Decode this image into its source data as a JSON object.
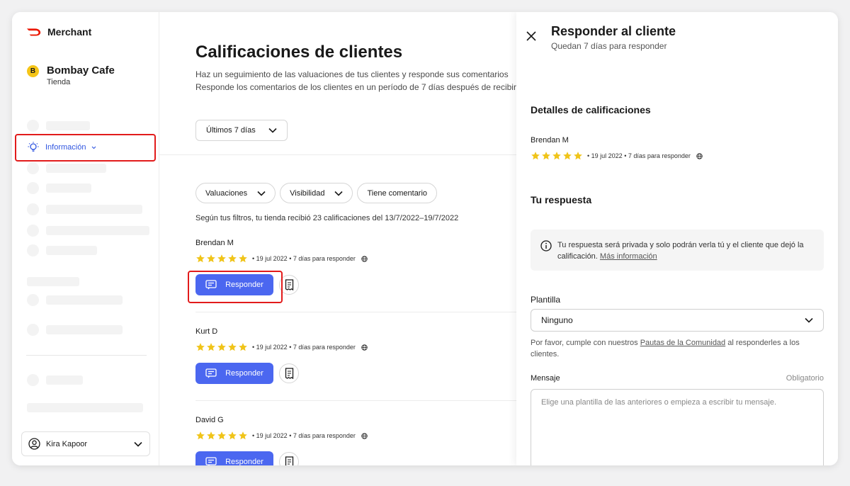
{
  "colors": {
    "primary": "#4b67f0",
    "highlight": "#e21b1b",
    "star": "#f0c419",
    "brand": "#eb1700",
    "link": "#2f55e0"
  },
  "sidebar": {
    "brand": "Merchant",
    "store_initial": "B",
    "store_name": "Bombay Cafe",
    "store_type": "Tienda",
    "active_nav": "Información",
    "user": "Kira Kapoor"
  },
  "main": {
    "title": "Calificaciones de clientes",
    "subtitle_line1": "Haz un seguimiento de las valuaciones de tus clientes y responde sus comentarios",
    "subtitle_line2": "Responde los comentarios de los clientes en un período de 7 días después de recibirlos",
    "date_filter": "Últimos 7 días",
    "filters": [
      "Valuaciones",
      "Visibilidad",
      "Tiene comentario"
    ],
    "filter_summary": "Según tus filtros, tu tienda recibió 23 calificaciones del 13/7/2022–19/7/2022",
    "reviews": [
      {
        "name": "Brendan M",
        "stars": 5,
        "meta": "• 19 jul 2022 • 7 días para responder",
        "action": "Responder"
      },
      {
        "name": "Kurt D",
        "stars": 5,
        "meta": "• 19 jul 2022 • 7 días para responder",
        "action": "Responder"
      },
      {
        "name": "David G",
        "stars": 5,
        "meta": "• 19 jul 2022 • 7 días para responder",
        "action": "Responder"
      }
    ]
  },
  "panel": {
    "title": "Responder al cliente",
    "subtitle": "Quedan 7 días para responder",
    "details_title": "Detalles de calificaciones",
    "reviewer": "Brendan M",
    "stars": 5,
    "meta": "• 19 jul 2022 • 7 días para responder",
    "response_title": "Tu respuesta",
    "info_text": "Tu respuesta será privada y solo podrán verla tú y el cliente que dejó la calificación.",
    "info_link": "Más información",
    "template_label": "Plantilla",
    "template_value": "Ninguno",
    "guide_prefix": "Por favor, cumple con nuestros",
    "guide_link": "Pautas de la Comunidad",
    "guide_suffix": "al responderles a los clientes.",
    "message_label": "Mensaje",
    "required_label": "Obligatorio",
    "message_placeholder": "Elige una plantilla de las anteriores o empieza a escribir tu mensaje."
  }
}
